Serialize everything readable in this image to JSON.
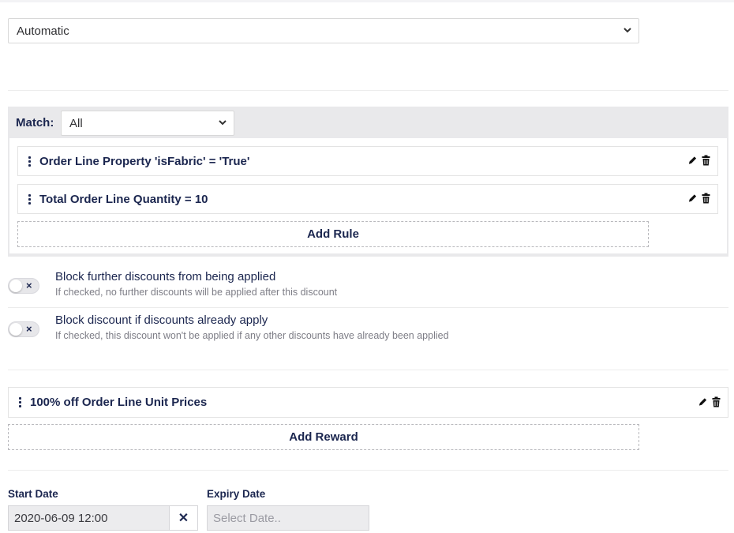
{
  "top_select": {
    "value": "Automatic"
  },
  "match": {
    "label": "Match:",
    "value": "All"
  },
  "rules": [
    {
      "label": "Order Line Property 'isFabric' = 'True'"
    },
    {
      "label": "Total Order Line Quantity = 10"
    }
  ],
  "add_rule_label": "Add Rule",
  "options": [
    {
      "title": "Block further discounts from being applied",
      "help": "If checked, no further discounts will be applied after this discount",
      "checked": false
    },
    {
      "title": "Block discount if discounts already apply",
      "help": "If checked, this discount won't be applied if any other discounts have already been applied",
      "checked": false
    }
  ],
  "rewards": [
    {
      "label": "100% off Order Line Unit Prices"
    }
  ],
  "add_reward_label": "Add Reward",
  "start_date": {
    "label": "Start Date",
    "value": "2020-06-09 12:00",
    "clear_glyph": "✕"
  },
  "expiry_date": {
    "label": "Expiry Date",
    "placeholder": "Select Date.."
  },
  "icons": {
    "edit": "pencil-icon",
    "delete": "trash-icon",
    "drag": "drag-handle-icon",
    "dropdown": "chevron-down-icon"
  },
  "colors": {
    "text_primary": "#1b264f",
    "panel_bg": "#e9e9eb",
    "help_text": "#7d7d86"
  }
}
